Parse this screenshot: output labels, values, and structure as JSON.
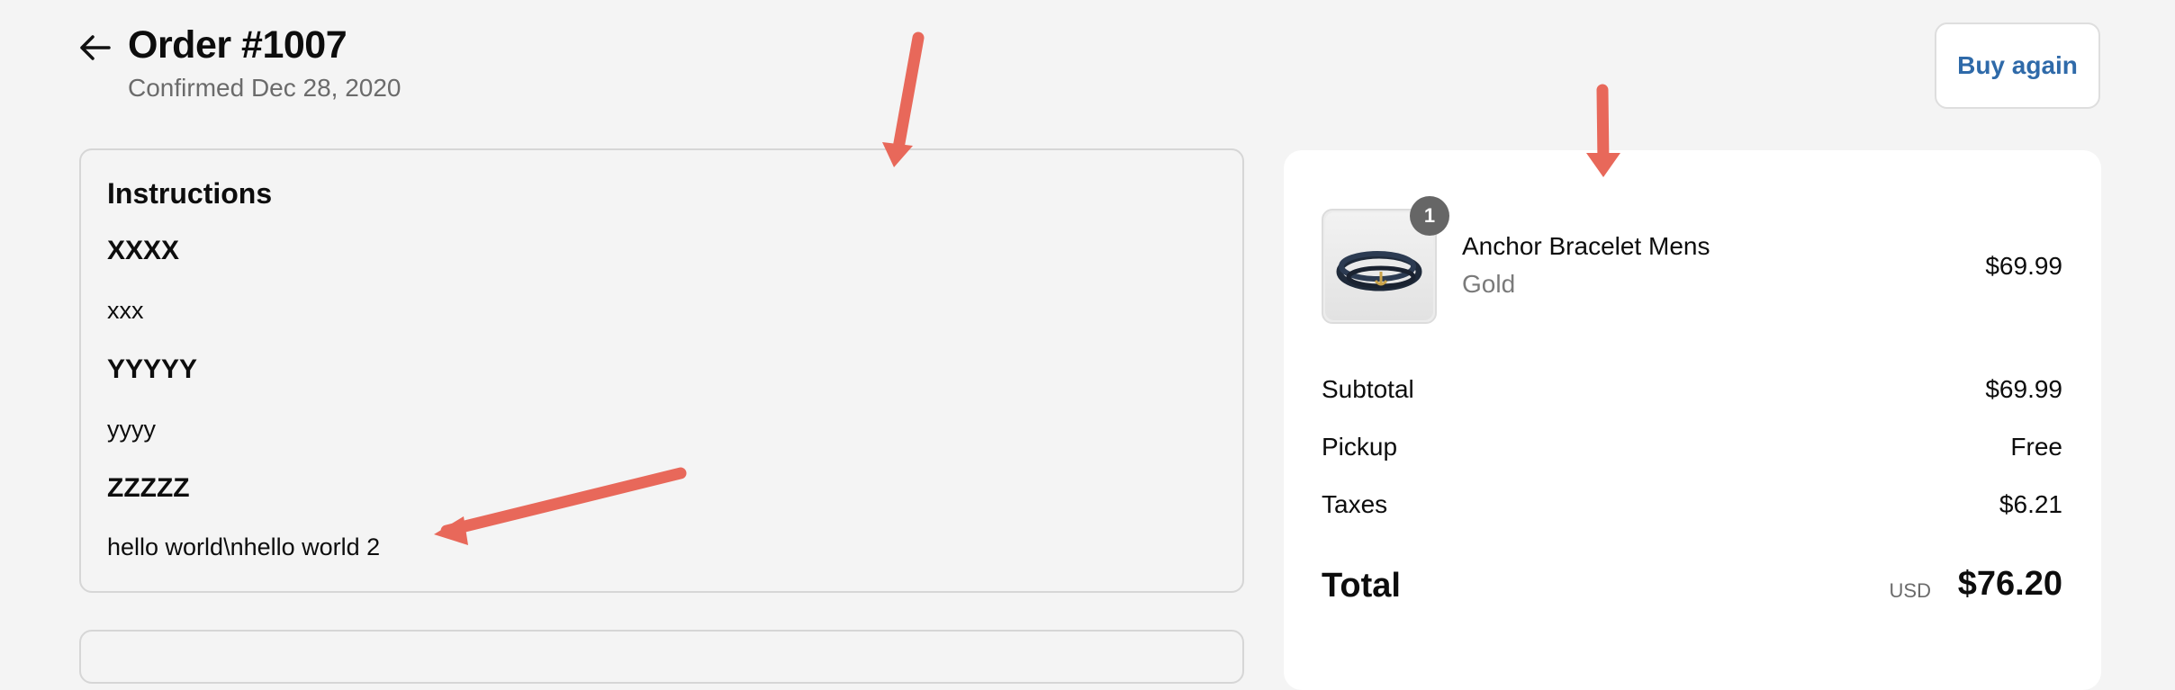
{
  "header": {
    "title": "Order #1007",
    "subtitle": "Confirmed Dec 28, 2020",
    "back_icon": "arrow-left-icon",
    "buy_again_label": "Buy again"
  },
  "instructions": {
    "heading": "Instructions",
    "items": [
      {
        "heading": "XXXX",
        "text": "xxx"
      },
      {
        "heading": "YYYYY",
        "text": "yyyy"
      },
      {
        "heading": "ZZZZZ",
        "text": "hello world\\nhello world 2"
      }
    ]
  },
  "summary": {
    "product": {
      "name": "Anchor Bracelet Mens",
      "variant": "Gold",
      "price": "$69.99",
      "quantity": "1"
    },
    "rows": [
      {
        "label": "Subtotal",
        "value": "$69.99"
      },
      {
        "label": "Pickup",
        "value": "Free"
      },
      {
        "label": "Taxes",
        "value": "$6.21"
      }
    ],
    "total": {
      "label": "Total",
      "currency": "USD",
      "value": "$76.20"
    }
  },
  "colors": {
    "background": "#f4f4f4",
    "link": "#2f6aa9",
    "annotation_arrow": "#e8685a",
    "badge": "#666666"
  }
}
